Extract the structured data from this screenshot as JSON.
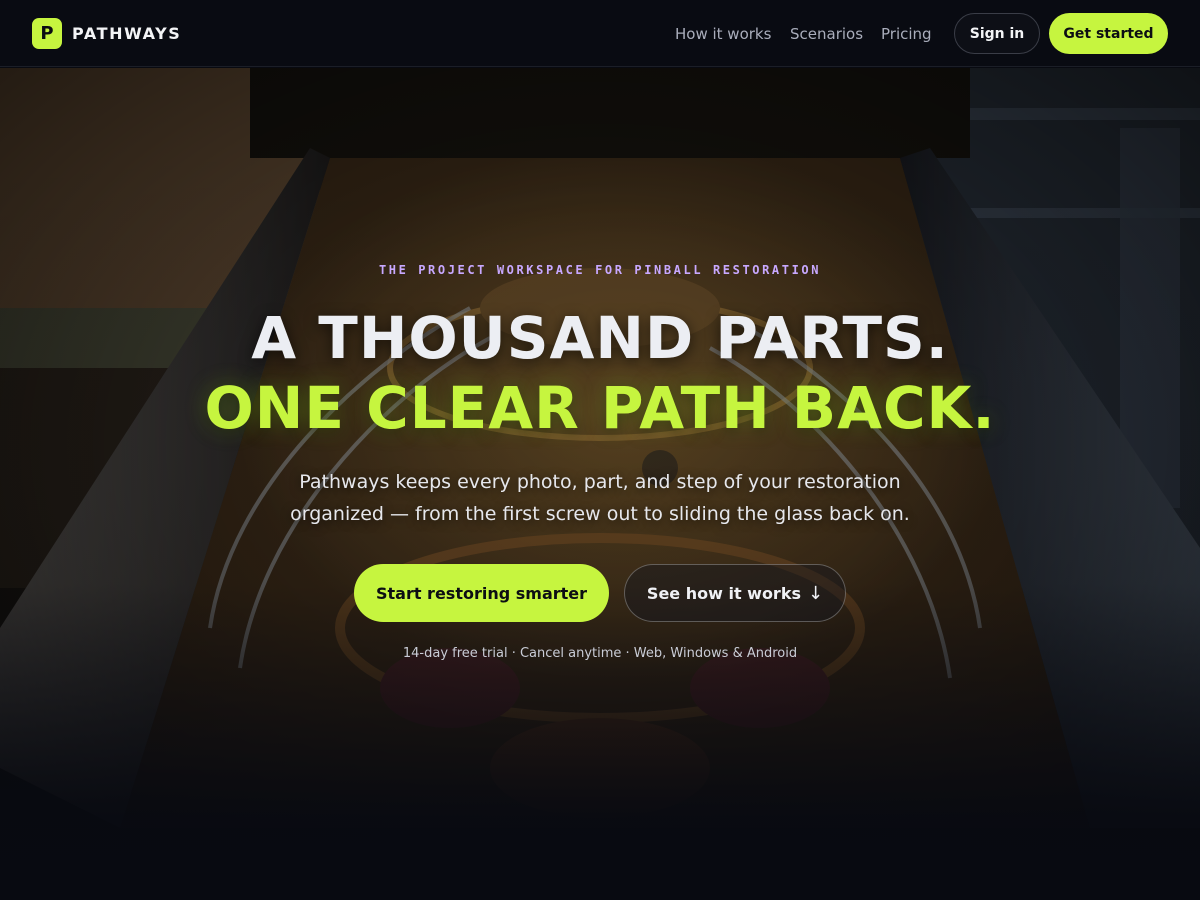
{
  "brand": {
    "logo_letter": "P",
    "name": "PATHWAYS",
    "accent": "#c6f53f"
  },
  "nav": {
    "links": [
      {
        "label": "How it works"
      },
      {
        "label": "Scenarios"
      },
      {
        "label": "Pricing"
      }
    ],
    "sign_in": "Sign in",
    "get_started": "Get started"
  },
  "hero": {
    "eyebrow": "THE PROJECT WORKSPACE FOR PINBALL RESTORATION",
    "headline_line1": "A THOUSAND PARTS.",
    "headline_line2": "ONE CLEAR PATH BACK.",
    "subcopy": "Pathways keeps every photo, part, and step of your restoration organized — from the first screw out to sliding the glass back on.",
    "cta_primary": "Start restoring smarter",
    "cta_secondary": "See how it works",
    "cta_secondary_icon": "arrow-down-icon",
    "fineprint": "14-day free trial · Cancel anytime · Web, Windows & Android",
    "eyebrow_color": "#c8a8ff"
  }
}
